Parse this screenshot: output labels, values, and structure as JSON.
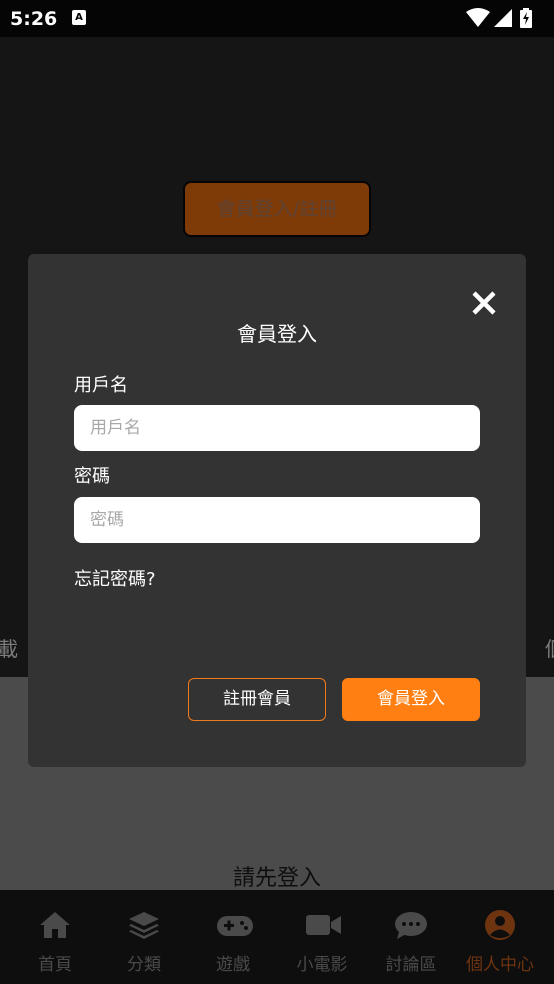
{
  "status_bar": {
    "time": "5:26",
    "app_icon_letter": "A",
    "icons": [
      "wifi-icon",
      "signal-icon",
      "battery-charging-icon"
    ]
  },
  "background_page": {
    "login_register_button": "會員登入/註冊",
    "edge_text_left": "載",
    "edge_text_right": "個",
    "please_login": "請先登入"
  },
  "modal": {
    "title": "會員登入",
    "close_icon": "close-icon",
    "username_label": "用戶名",
    "username_placeholder": "用戶名",
    "username_value": "",
    "password_label": "密碼",
    "password_placeholder": "密碼",
    "password_value": "",
    "forgot_password": "忘記密碼?",
    "register_button": "註冊會員",
    "login_button": "會員登入"
  },
  "bottom_nav": {
    "items": [
      {
        "label": "首頁",
        "icon": "home-icon"
      },
      {
        "label": "分類",
        "icon": "layers-icon"
      },
      {
        "label": "遊戲",
        "icon": "gamepad-icon"
      },
      {
        "label": "小電影",
        "icon": "video-camera-icon"
      },
      {
        "label": "討論區",
        "icon": "chat-bubble-icon"
      },
      {
        "label": "個人中心",
        "icon": "user-icon"
      }
    ],
    "active_index": 5
  },
  "colors": {
    "accent": "#ff7f12",
    "modal_bg": "#333333",
    "nav_bg": "#0e0e0e"
  }
}
